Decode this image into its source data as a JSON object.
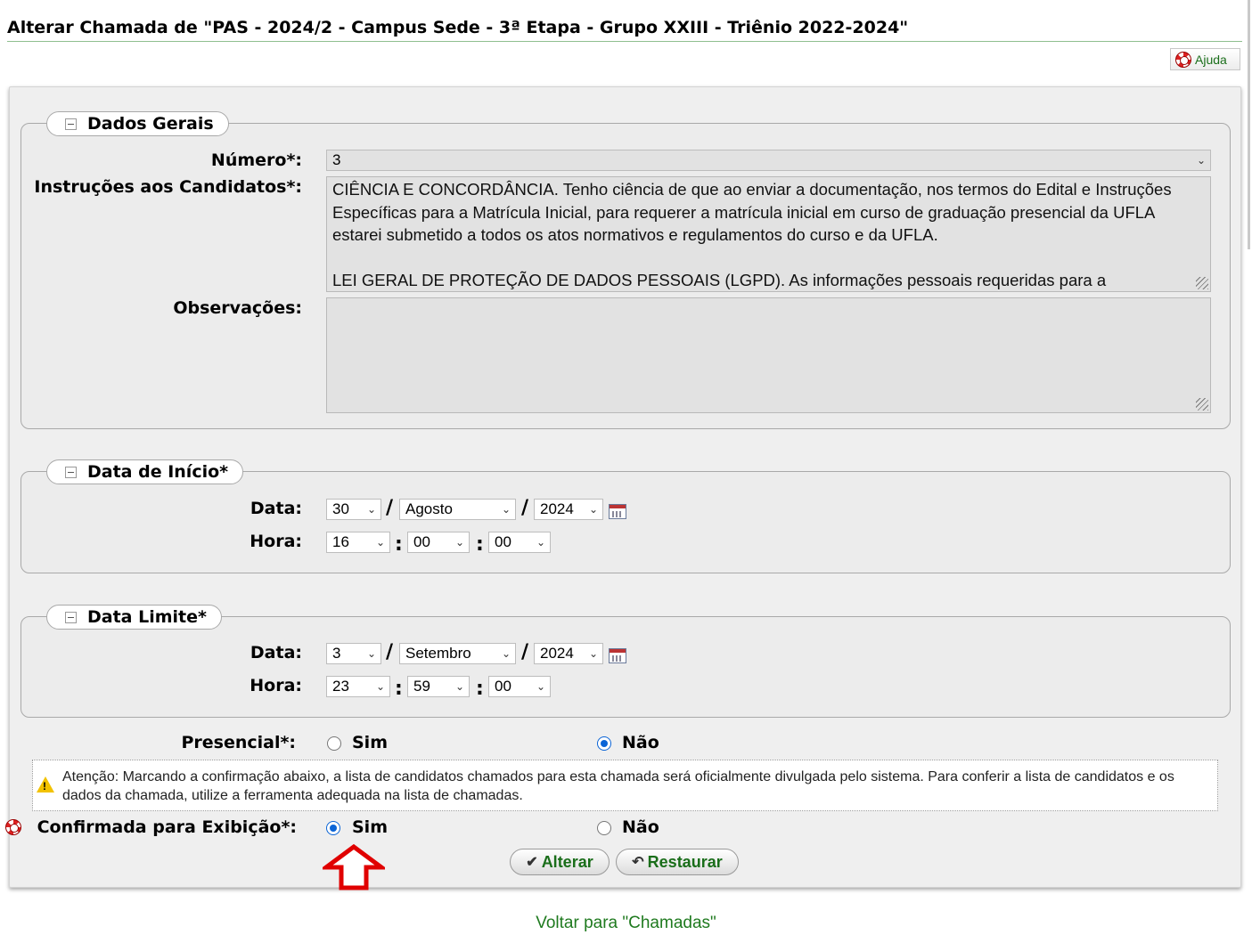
{
  "page": {
    "title": "Alterar Chamada de \"PAS - 2024/2 - Campus Sede - 3ª Etapa - Grupo XXIII - Triênio 2022-2024\"",
    "help_label": "Ajuda",
    "back_link": "Voltar para \"Chamadas\""
  },
  "dados_gerais": {
    "legend": "Dados Gerais",
    "numero_label": "Número*:",
    "numero_value": "3",
    "instrucoes_label": "Instruções aos Candidatos*:",
    "instrucoes_value": "CIÊNCIA E CONCORDÂNCIA. Tenho ciência de que ao enviar a documentação, nos termos do Edital e Instruções Específicas para a Matrícula Inicial, para requerer a matrícula inicial em curso de graduação presencial da UFLA estarei submetido a todos os atos normativos e regulamentos do curso e da UFLA.\n\nLEI GERAL DE PROTEÇÃO DE DADOS PESSOAIS (LGPD). As informações pessoais requeridas para a",
    "observacoes_label": "Observações:",
    "observacoes_value": ""
  },
  "data_inicio": {
    "legend": "Data de Início*",
    "data_label": "Data:",
    "hora_label": "Hora:",
    "dia": "30",
    "mes": "Agosto",
    "ano": "2024",
    "hora": "16",
    "minuto": "00",
    "segundo": "00"
  },
  "data_limite": {
    "legend": "Data Limite*",
    "data_label": "Data:",
    "hora_label": "Hora:",
    "dia": "3",
    "mes": "Setembro",
    "ano": "2024",
    "hora": "23",
    "minuto": "59",
    "segundo": "00"
  },
  "separators": {
    "date": "/",
    "time": ":"
  },
  "presencial": {
    "label": "Presencial*:",
    "sim": "Sim",
    "nao": "Não",
    "selected": "Não"
  },
  "warning": {
    "text": "Atenção: Marcando a confirmação abaixo, a lista de candidatos chamados para esta chamada será oficialmente divulgada pelo sistema. Para conferir a lista de candidatos e os dados da chamada, utilize a ferramenta adequada na lista de chamadas."
  },
  "confirmada": {
    "label": "Confirmada para Exibição*:",
    "sim": "Sim",
    "nao": "Não",
    "selected": "Sim"
  },
  "buttons": {
    "alterar": "Alterar",
    "restaurar": "Restaurar"
  },
  "icons": {
    "help": "lifebuoy-icon",
    "collapse": "collapse-icon",
    "calendar": "calendar-icon",
    "warning": "warning-icon",
    "check": "check-icon",
    "undo": "undo-icon",
    "annotation_arrow": "red-arrow-up-icon"
  },
  "colors": {
    "accent_green": "#1a6e1a",
    "radio_blue": "#0a64d6",
    "panel_bg": "#efefef",
    "annotation_red": "#e00000"
  }
}
